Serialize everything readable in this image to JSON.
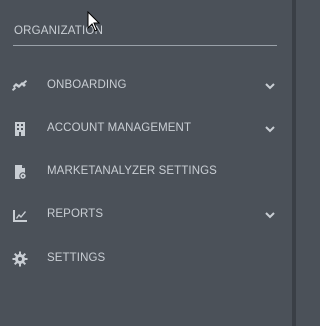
{
  "sidebar": {
    "section_title": "ORGANIZATION",
    "items": [
      {
        "label": "ONBOARDING",
        "icon": "handshake-icon",
        "has_chevron": true
      },
      {
        "label": "ACCOUNT MANAGEMENT",
        "icon": "building-icon",
        "has_chevron": true
      },
      {
        "label": "MARKETANALYZER SETTINGS",
        "icon": "file-gear-icon",
        "has_chevron": false
      },
      {
        "label": "REPORTS",
        "icon": "chart-icon",
        "has_chevron": true
      },
      {
        "label": "SETTINGS",
        "icon": "gear-icon",
        "has_chevron": false
      }
    ]
  },
  "colors": {
    "background": "#4b5159",
    "text": "#c9ced4",
    "divider": "#9aa1a9",
    "edge": "#3a3f46"
  }
}
